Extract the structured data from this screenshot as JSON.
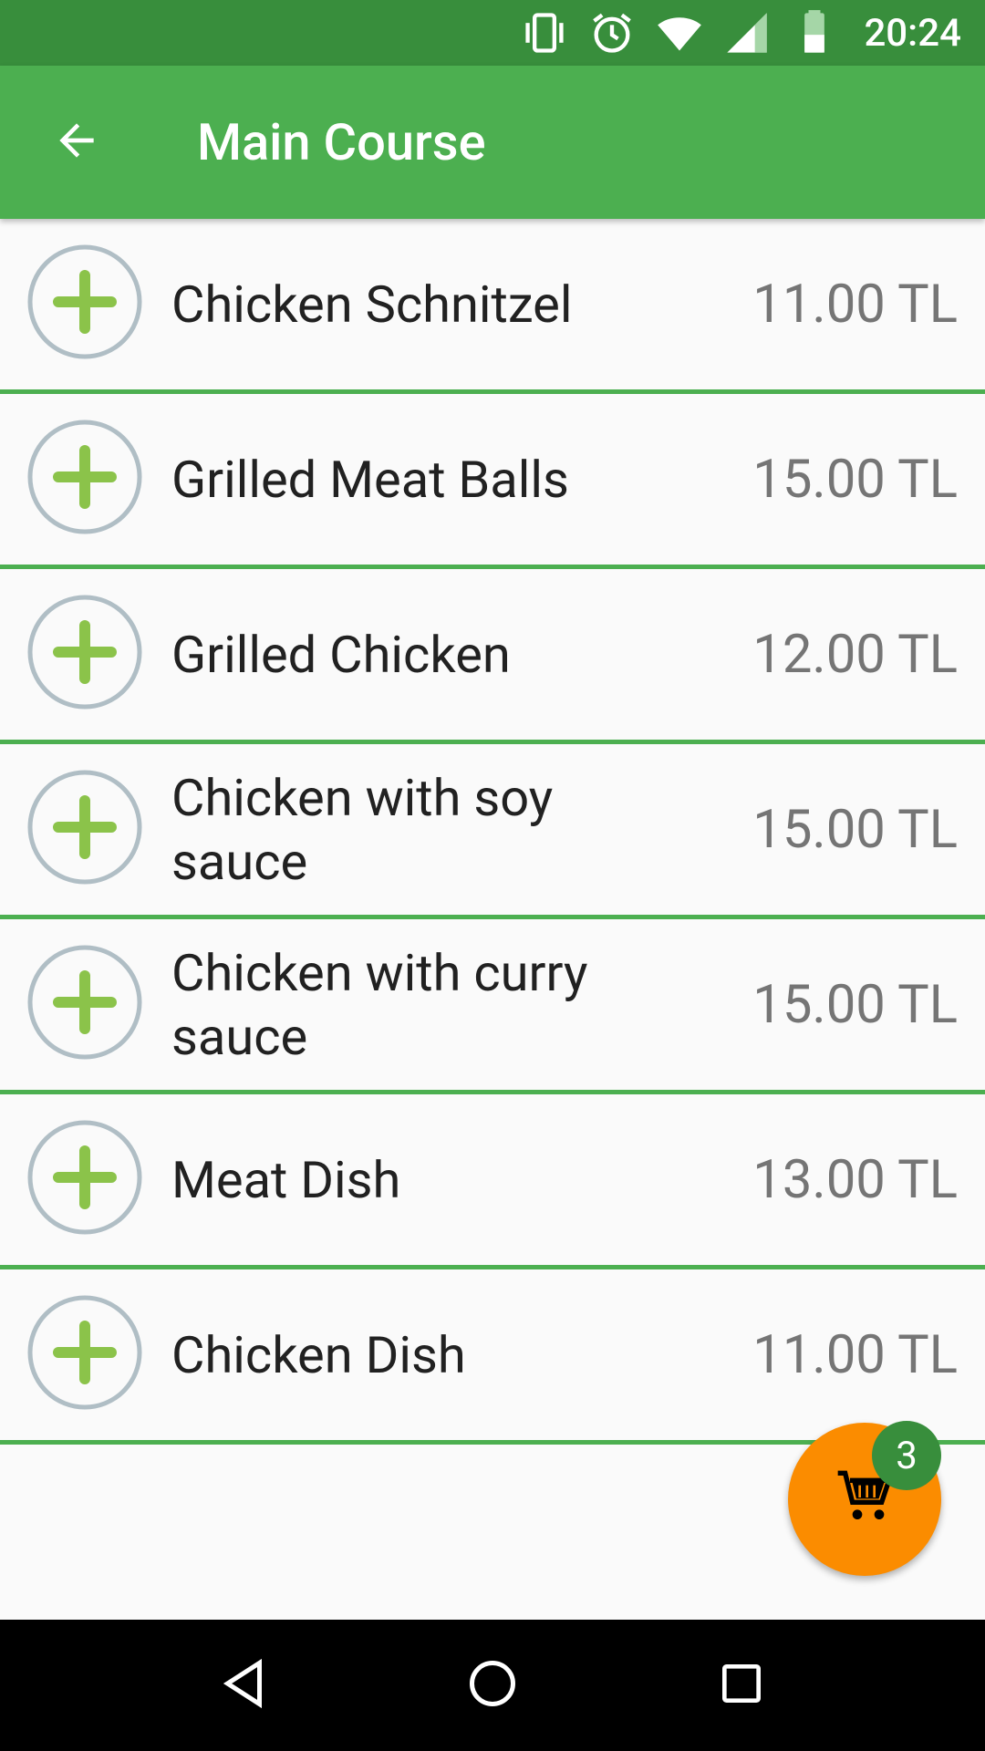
{
  "status_bar": {
    "time": "20:24",
    "icons": [
      "vibrate-icon",
      "alarm-icon",
      "wifi-icon",
      "cell-signal-icon",
      "battery-icon"
    ]
  },
  "app_bar": {
    "title": "Main Course",
    "back_icon": "arrow-back-icon"
  },
  "menu": {
    "items": [
      {
        "name": "Chicken Schnitzel",
        "price": "11.00 TL"
      },
      {
        "name": "Grilled Meat Balls",
        "price": "15.00 TL"
      },
      {
        "name": "Grilled Chicken",
        "price": "12.00 TL"
      },
      {
        "name": "Chicken with soy sauce",
        "price": "15.00 TL"
      },
      {
        "name": "Chicken with curry sauce",
        "price": "15.00 TL"
      },
      {
        "name": "Meat Dish",
        "price": "13.00 TL"
      },
      {
        "name": "Chicken Dish",
        "price": "11.00 TL"
      }
    ]
  },
  "cart": {
    "count": "3",
    "icon": "shopping-cart-icon"
  },
  "navigation": {
    "icons": [
      "back-triangle-icon",
      "home-circle-icon",
      "recents-square-icon"
    ]
  },
  "colors": {
    "status_bar": "#388e3c",
    "app_bar": "#4caf50",
    "divider": "#4caf50",
    "fab": "#fb8c00",
    "badge": "#388e3c",
    "plus": "#8bc34a"
  }
}
